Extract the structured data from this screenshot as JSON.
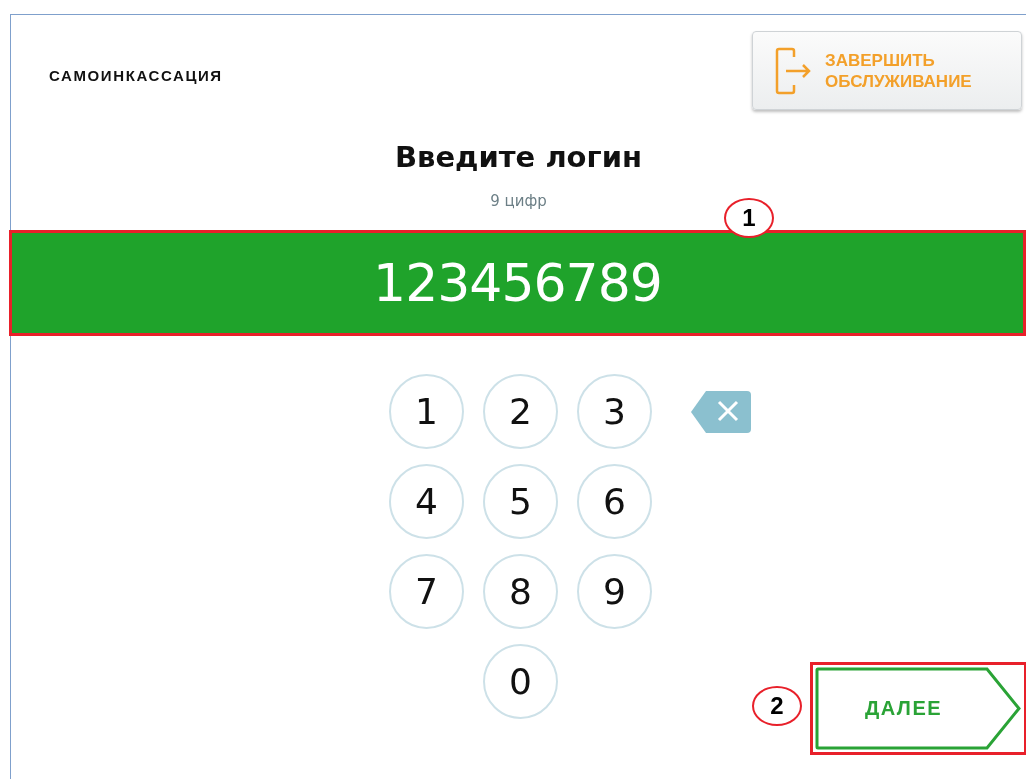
{
  "header": {
    "title": "САМОИНКАССАЦИЯ",
    "end_button": {
      "label": "ЗАВЕРШИТЬ ОБСЛУЖИВАНИЕ"
    }
  },
  "prompt": {
    "heading": "Введите логин",
    "hint": "9 цифр"
  },
  "login_field": {
    "value": "123456789",
    "highlighted": true
  },
  "keypad": {
    "keys": [
      "1",
      "2",
      "3",
      "4",
      "5",
      "6",
      "7",
      "8",
      "9",
      "0"
    ]
  },
  "next_button": {
    "label": "ДАЛЕЕ",
    "highlighted": true
  },
  "annotations": [
    {
      "number": "1"
    },
    {
      "number": "2"
    }
  ]
}
